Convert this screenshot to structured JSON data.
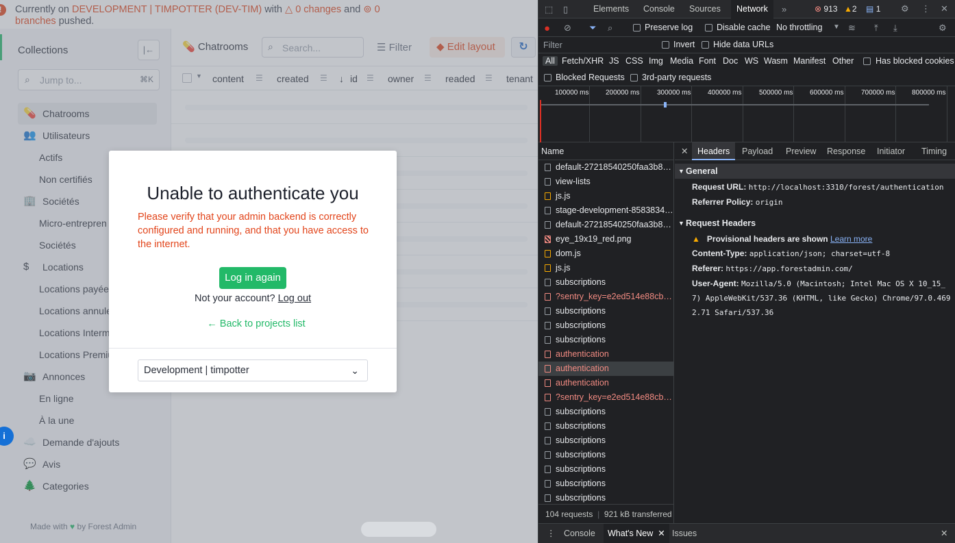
{
  "banner": {
    "prefix": "Currently on",
    "env": "DEVELOPMENT | TIMPOTTER (DEV-TIM)",
    "with": "with",
    "changes": "0 changes",
    "and": "and",
    "branches_count": "0",
    "branches": "branches",
    "suffix": "pushed."
  },
  "sidebar": {
    "title": "Collections",
    "jump_placeholder": "Jump to...",
    "jump_shortcut": "⌘K",
    "items": [
      {
        "label": "Chatrooms",
        "icon": "💊",
        "level": "top",
        "active": true
      },
      {
        "label": "Utilisateurs",
        "icon": "👥",
        "level": "top"
      },
      {
        "label": "Actifs",
        "level": "sub"
      },
      {
        "label": "Non certifiés",
        "level": "sub"
      },
      {
        "label": "Sociétés",
        "icon": "🏢",
        "level": "top"
      },
      {
        "label": "Micro-entrepren",
        "level": "sub"
      },
      {
        "label": "Sociétés",
        "level": "sub"
      },
      {
        "label": "Locations",
        "icon": "$",
        "level": "top"
      },
      {
        "label": "Locations payée",
        "level": "sub"
      },
      {
        "label": "Locations annule",
        "level": "sub"
      },
      {
        "label": "Locations Interm",
        "level": "sub"
      },
      {
        "label": "Locations Premiu",
        "level": "sub"
      },
      {
        "label": "Annonces",
        "icon": "📷",
        "level": "top"
      },
      {
        "label": "En ligne",
        "level": "sub"
      },
      {
        "label": "À la une",
        "level": "sub"
      },
      {
        "label": "Demande d'ajouts",
        "icon": "☁️",
        "level": "top"
      },
      {
        "label": "Avis",
        "icon": "💬",
        "level": "top"
      },
      {
        "label": "Categories",
        "icon": "🌲",
        "level": "top"
      }
    ],
    "footer_pre": "Made with",
    "footer_post": "by Forest Admin"
  },
  "toolbar": {
    "collection": "Chatrooms",
    "search_placeholder": "Search...",
    "filter": "Filter",
    "edit_layout": "Edit layout"
  },
  "table": {
    "columns": [
      "content",
      "created",
      "id",
      "owner",
      "readed",
      "tenant"
    ]
  },
  "modal": {
    "title": "Unable to authenticate you",
    "message": "Please verify that your admin backend is correctly configured and running, and that you have access to the internet.",
    "login_button": "Log in again",
    "not_your_account": "Not your account?",
    "logout": "Log out",
    "back": "Back to projects list",
    "project_select": "Development | timpotter"
  },
  "devtools": {
    "tabs": [
      "Elements",
      "Console",
      "Sources",
      "Network"
    ],
    "active_tab": "Network",
    "errors": "913",
    "warnings": "2",
    "messages": "1",
    "preserve_log": "Preserve log",
    "disable_cache": "Disable cache",
    "throttling": "No throttling",
    "filter_placeholder": "Filter",
    "invert": "Invert",
    "hide_data_urls": "Hide data URLs",
    "types": [
      "All",
      "Fetch/XHR",
      "JS",
      "CSS",
      "Img",
      "Media",
      "Font",
      "Doc",
      "WS",
      "Wasm",
      "Manifest",
      "Other"
    ],
    "has_blocked_cookies": "Has blocked cookies",
    "blocked_requests": "Blocked Requests",
    "third_party": "3rd-party requests",
    "timeline_ticks": [
      "100000 ms",
      "200000 ms",
      "300000 ms",
      "400000 ms",
      "500000 ms",
      "600000 ms",
      "700000 ms",
      "800000 ms"
    ],
    "name_header": "Name",
    "requests": [
      {
        "name": "default-27218540250faa3b8…",
        "kind": "doc"
      },
      {
        "name": "view-lists",
        "kind": "doc"
      },
      {
        "name": "js.js",
        "kind": "js"
      },
      {
        "name": "stage-development-8583834…",
        "kind": "doc"
      },
      {
        "name": "default-27218540250faa3b8…",
        "kind": "doc"
      },
      {
        "name": "eye_19x19_red.png",
        "kind": "img"
      },
      {
        "name": "dom.js",
        "kind": "js"
      },
      {
        "name": "js.js",
        "kind": "js"
      },
      {
        "name": "subscriptions",
        "kind": "doc"
      },
      {
        "name": "?sentry_key=e2ed514e88cb…",
        "kind": "err"
      },
      {
        "name": "subscriptions",
        "kind": "doc"
      },
      {
        "name": "subscriptions",
        "kind": "doc"
      },
      {
        "name": "subscriptions",
        "kind": "doc"
      },
      {
        "name": "authentication",
        "kind": "err"
      },
      {
        "name": "authentication",
        "kind": "err",
        "selected": true
      },
      {
        "name": "authentication",
        "kind": "err"
      },
      {
        "name": "?sentry_key=e2ed514e88cb…",
        "kind": "err"
      },
      {
        "name": "subscriptions",
        "kind": "doc"
      },
      {
        "name": "subscriptions",
        "kind": "doc"
      },
      {
        "name": "subscriptions",
        "kind": "doc"
      },
      {
        "name": "subscriptions",
        "kind": "doc"
      },
      {
        "name": "subscriptions",
        "kind": "doc"
      },
      {
        "name": "subscriptions",
        "kind": "doc"
      },
      {
        "name": "subscriptions",
        "kind": "doc"
      }
    ],
    "detail_tabs": [
      "Headers",
      "Payload",
      "Preview",
      "Response",
      "Initiator",
      "Timing"
    ],
    "general_title": "General",
    "request_url_label": "Request URL:",
    "request_url": "http://localhost:3310/forest/authentication",
    "referrer_policy_label": "Referrer Policy:",
    "referrer_policy": "origin",
    "request_headers_title": "Request Headers",
    "provisional": "Provisional headers are shown",
    "learn_more": "Learn more",
    "content_type_label": "Content-Type:",
    "content_type": "application/json; charset=utf-8",
    "referer_label": "Referer:",
    "referer": "https://app.forestadmin.com/",
    "user_agent_label": "User-Agent:",
    "user_agent_1": "Mozilla/5.0 (Macintosh; Intel Mac OS X 10_15_",
    "user_agent_2": "7) AppleWebKit/537.36 (KHTML, like Gecko) Chrome/97.0.469",
    "user_agent_3": "2.71 Safari/537.36",
    "status_requests": "104 requests",
    "status_transferred": "921 kB transferred",
    "drawer_tabs": [
      "Console",
      "What's New",
      "Issues"
    ]
  }
}
